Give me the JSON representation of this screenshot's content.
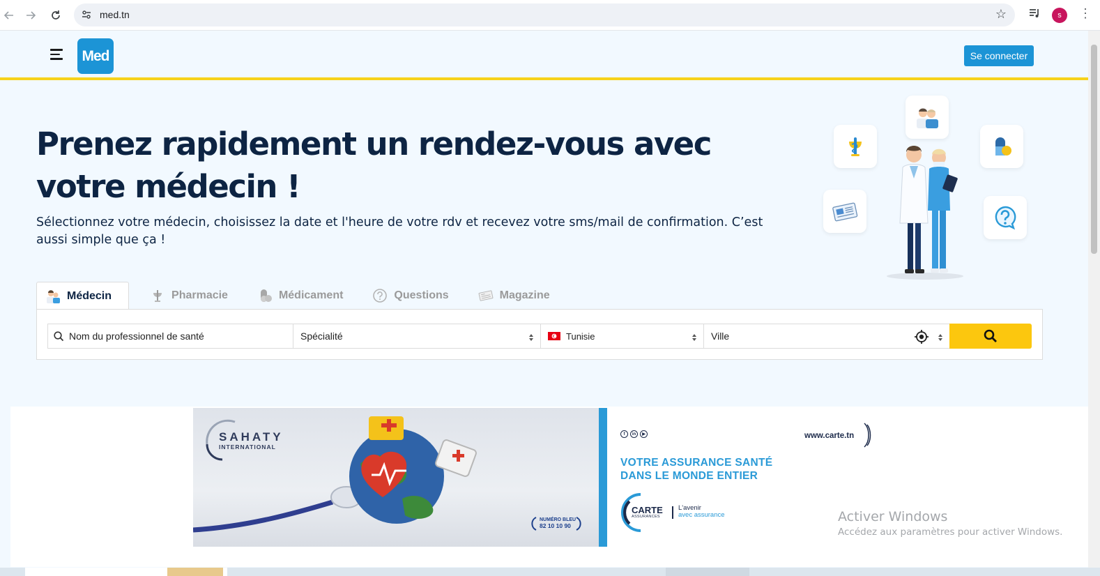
{
  "browser": {
    "url": "med.tn",
    "profile_initial": "s"
  },
  "header": {
    "logo_text": "Med",
    "login_label": "Se connecter"
  },
  "hero": {
    "title": "Prenez rapidement un rendez-vous avec votre médecin !",
    "subtitle": "Sélectionnez votre médecin, choisissez la date et l'heure de votre rdv et recevez votre sms/mail de confirmation. C’est aussi simple que ça !"
  },
  "tabs": [
    {
      "label": "Médecin",
      "icon": "doctor-icon",
      "active": true
    },
    {
      "label": "Pharmacie",
      "icon": "pharmacy-icon",
      "active": false
    },
    {
      "label": "Médicament",
      "icon": "pill-icon",
      "active": false
    },
    {
      "label": "Questions",
      "icon": "question-icon",
      "active": false
    },
    {
      "label": "Magazine",
      "icon": "newspaper-icon",
      "active": false
    }
  ],
  "search": {
    "name_placeholder": "Nom du professionnel de santé",
    "specialty_value": "Spécialité",
    "country_value": "Tunisie",
    "city_placeholder": "Ville"
  },
  "banner": {
    "brand": "SAHATY",
    "brand_sub": "INTERNATIONAL",
    "numero_label": "NUMÉRO BLEU",
    "numero_value": "82 10 10 90",
    "website": "www.carte.tn",
    "headline_line1": "VOTRE ASSURANCE SANTÉ",
    "headline_line2": "DANS LE MONDE ENTIER",
    "carte_name": "CARTE",
    "carte_sub": "ASSURANCES",
    "slogan_line1": "L'avenir",
    "slogan_line2": "avec assurance"
  },
  "watermark": {
    "line1": "Activer Windows",
    "line2": "Accédez aux paramètres pour activer Windows."
  },
  "colors": {
    "brand_blue": "#1c94d6",
    "accent_yellow": "#f7d21b",
    "search_yellow": "#fcc70e",
    "text_navy": "#0d2443"
  }
}
